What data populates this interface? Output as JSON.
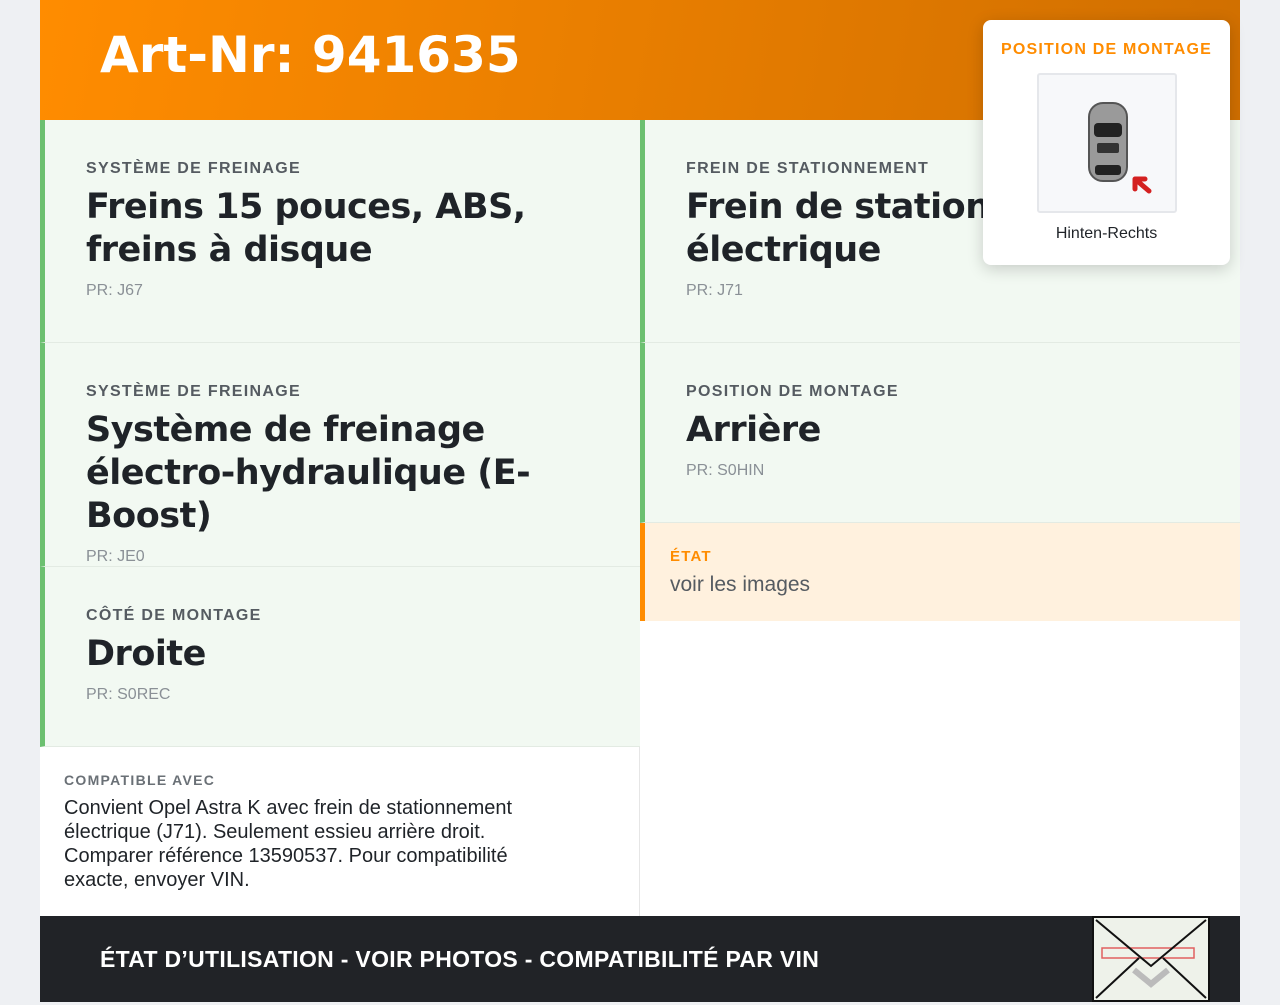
{
  "header": {
    "title": "Art-Nr: 941635"
  },
  "cells": [
    {
      "label": "Système de freinage",
      "value": "Freins 15 pouces, ABS, freins à disque",
      "pr": "PR: J67"
    },
    {
      "label": "Frein de stationnement",
      "value": "Frein de stationnement électrique",
      "pr": "PR: J71"
    },
    {
      "label": "Système de freinage",
      "value": "Système de freinage électro-hydraulique (E-Boost)",
      "pr": "PR: JE0"
    },
    {
      "label": "Position de montage",
      "value": "Arrière",
      "pr": "PR: S0HIN"
    },
    {
      "label": "Côté de montage",
      "value": "Droite",
      "pr": "PR: S0REC"
    }
  ],
  "etat": {
    "label": "ÉTAT",
    "value": "voir les images"
  },
  "compat": {
    "label": "COMPATIBLE AVEC",
    "text": "Convient Opel Astra K avec frein de stationnement électrique (J71). Seulement essieu arrière droit. Comparer référence 13590537. Pour compatibilité exacte, envoyer VIN."
  },
  "footer": {
    "text": "ÉTAT D’UTILISATION - VOIR PHOTOS - COMPATIBILITÉ PAR VIN"
  },
  "popup": {
    "label": "POSITION DE MONTAGE",
    "position": "Hinten-Rechts"
  }
}
